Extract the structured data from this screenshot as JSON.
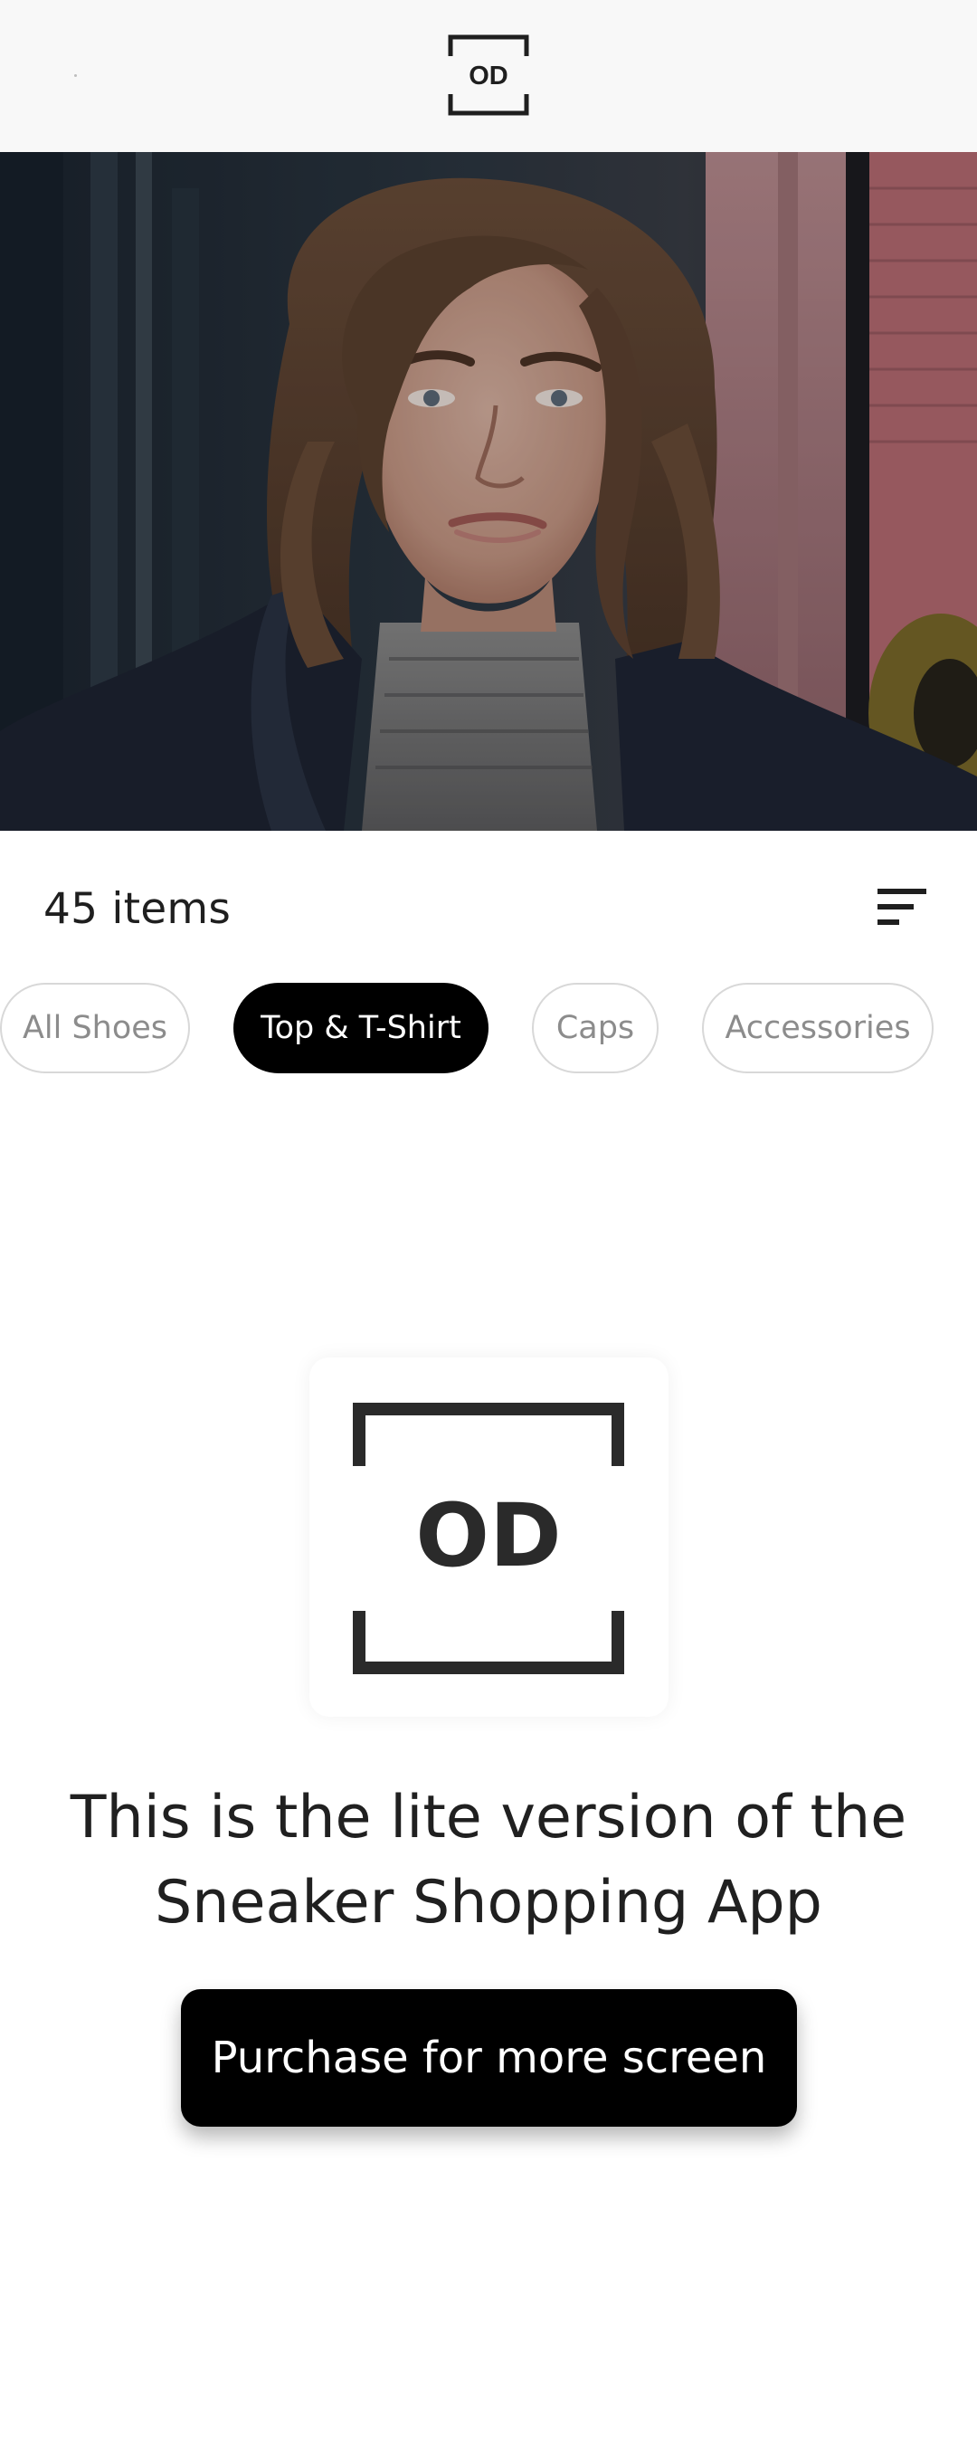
{
  "header": {
    "logo_text": "OD",
    "back_icon": "back-arrow-icon"
  },
  "hero": {
    "image_subject": "person-portrait"
  },
  "listing": {
    "items_count": "45 items",
    "filter_icon": "sort-filter-icon"
  },
  "categories": [
    {
      "label": "All Shoes",
      "active": false
    },
    {
      "label": "Top & T-Shirt",
      "active": true
    },
    {
      "label": "Caps",
      "active": false
    },
    {
      "label": "Accessories",
      "active": false
    }
  ],
  "promo": {
    "logo_text": "OD",
    "message_line1": "This is the lite version of the",
    "message_line2": "Sneaker Shopping App",
    "button_label": "Purchase for more screen"
  },
  "colors": {
    "header_bg": "#f8f8f8",
    "accent": "#000000",
    "chip_border": "#d8d8d8",
    "chip_text": "#8c8c8c",
    "text": "#1f1f1f"
  }
}
